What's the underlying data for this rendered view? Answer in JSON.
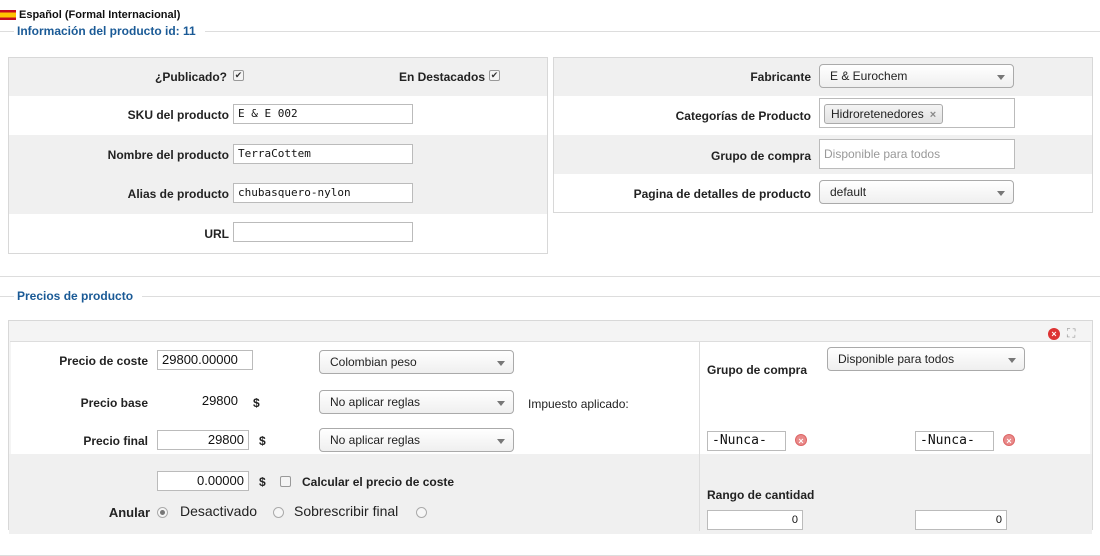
{
  "language": "Español (Formal Internacional)",
  "info": {
    "legend": "Información del producto id: 11",
    "published_label": "¿Publicado?",
    "published": true,
    "featured_label": "En Destacados",
    "featured": true,
    "sku_label": "SKU del producto",
    "sku_value": "E & E 002",
    "name_label": "Nombre del producto",
    "name_value": "TerraCottem",
    "alias_label": "Alias de producto",
    "alias_value": "chubasquero-nylon",
    "url_label": "URL",
    "url_value": "",
    "manufacturer_label": "Fabricante",
    "manufacturer_value": "E & Eurochem",
    "categories_label": "Categorías de Producto",
    "category_tag": "Hidroretenedores",
    "tag_remove": "×",
    "shopper_group_label": "Grupo de compra",
    "shopper_group_placeholder": "Disponible para todos",
    "details_page_label": "Pagina de detalles de producto",
    "details_page_value": "default"
  },
  "prices": {
    "legend": "Precios de producto",
    "close_icon": "×",
    "expand_icon": "⛶",
    "cost_label": "Precio de coste",
    "cost_value": "29800.00000",
    "currency_value": "Colombian peso",
    "base_label": "Precio base",
    "base_value": "29800",
    "base_currency": "$",
    "base_rule": "No aplicar reglas",
    "tax_applied_label": "Impuesto aplicado:",
    "final_label": "Precio final",
    "final_value": "29800",
    "final_currency": "$",
    "final_rule": "No aplicar reglas",
    "override_value": "0.00000",
    "override_currency": "$",
    "calc_cost_label": "Calcular el precio de coste",
    "cancel_label": "Anular",
    "disabled_label": "Desactivado",
    "overwrite_label": "Sobrescribir final",
    "shopper_group_label": "Grupo de compra",
    "shopper_group_value": "Disponible para todos",
    "date_start": "-Nunca-",
    "date_end": "-Nunca-",
    "date_clear": "×",
    "quantity_range_label": "Rango de cantidad",
    "qty_start": "0",
    "qty_end": "0"
  }
}
